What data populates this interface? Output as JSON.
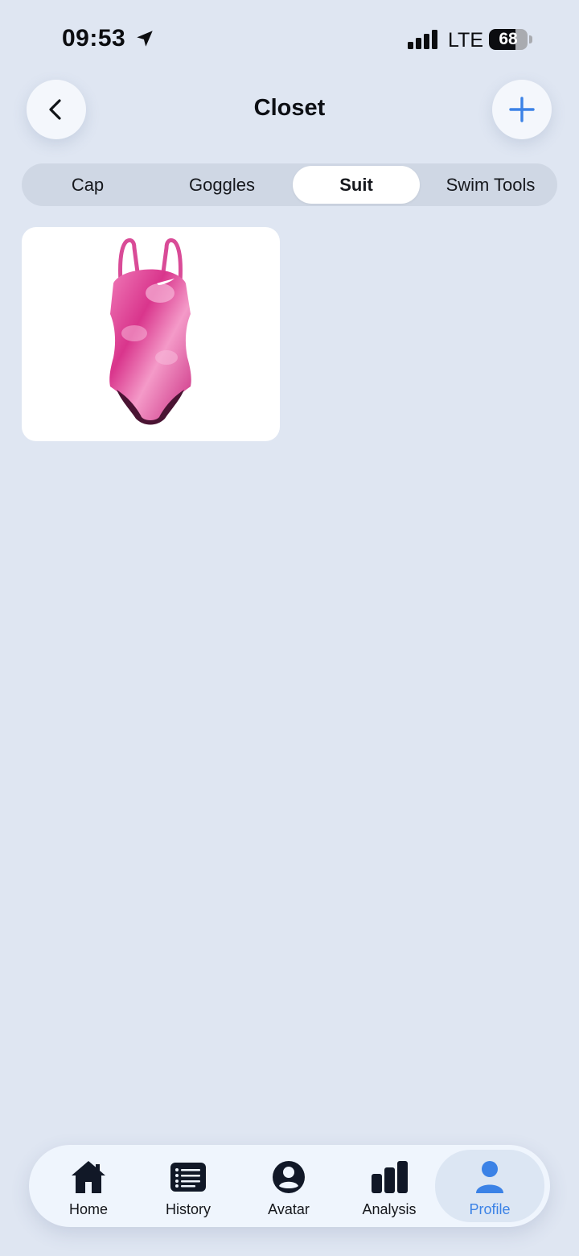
{
  "status_bar": {
    "time": "09:53",
    "network": "LTE",
    "battery_percent": "68",
    "battery_level": 0.68
  },
  "header": {
    "title": "Closet",
    "back_icon": "chevron-left-icon",
    "add_icon": "plus-icon"
  },
  "tabs": [
    {
      "label": "Cap",
      "active": false
    },
    {
      "label": "Goggles",
      "active": false
    },
    {
      "label": "Suit",
      "active": true
    },
    {
      "label": "Swim Tools",
      "active": false
    }
  ],
  "items": [
    {
      "kind": "swimsuit",
      "color": "#e04f9a"
    }
  ],
  "bottom_nav": {
    "items": [
      {
        "label": "Home",
        "icon": "home-icon",
        "active": false
      },
      {
        "label": "History",
        "icon": "list-icon",
        "active": false
      },
      {
        "label": "Avatar",
        "icon": "avatar-icon",
        "active": false
      },
      {
        "label": "Analysis",
        "icon": "bar-chart-icon",
        "active": false
      },
      {
        "label": "Profile",
        "icon": "profile-icon",
        "active": true
      }
    ]
  },
  "colors": {
    "background": "#dfe6f2",
    "accent": "#3b82e6",
    "text": "#111418"
  }
}
